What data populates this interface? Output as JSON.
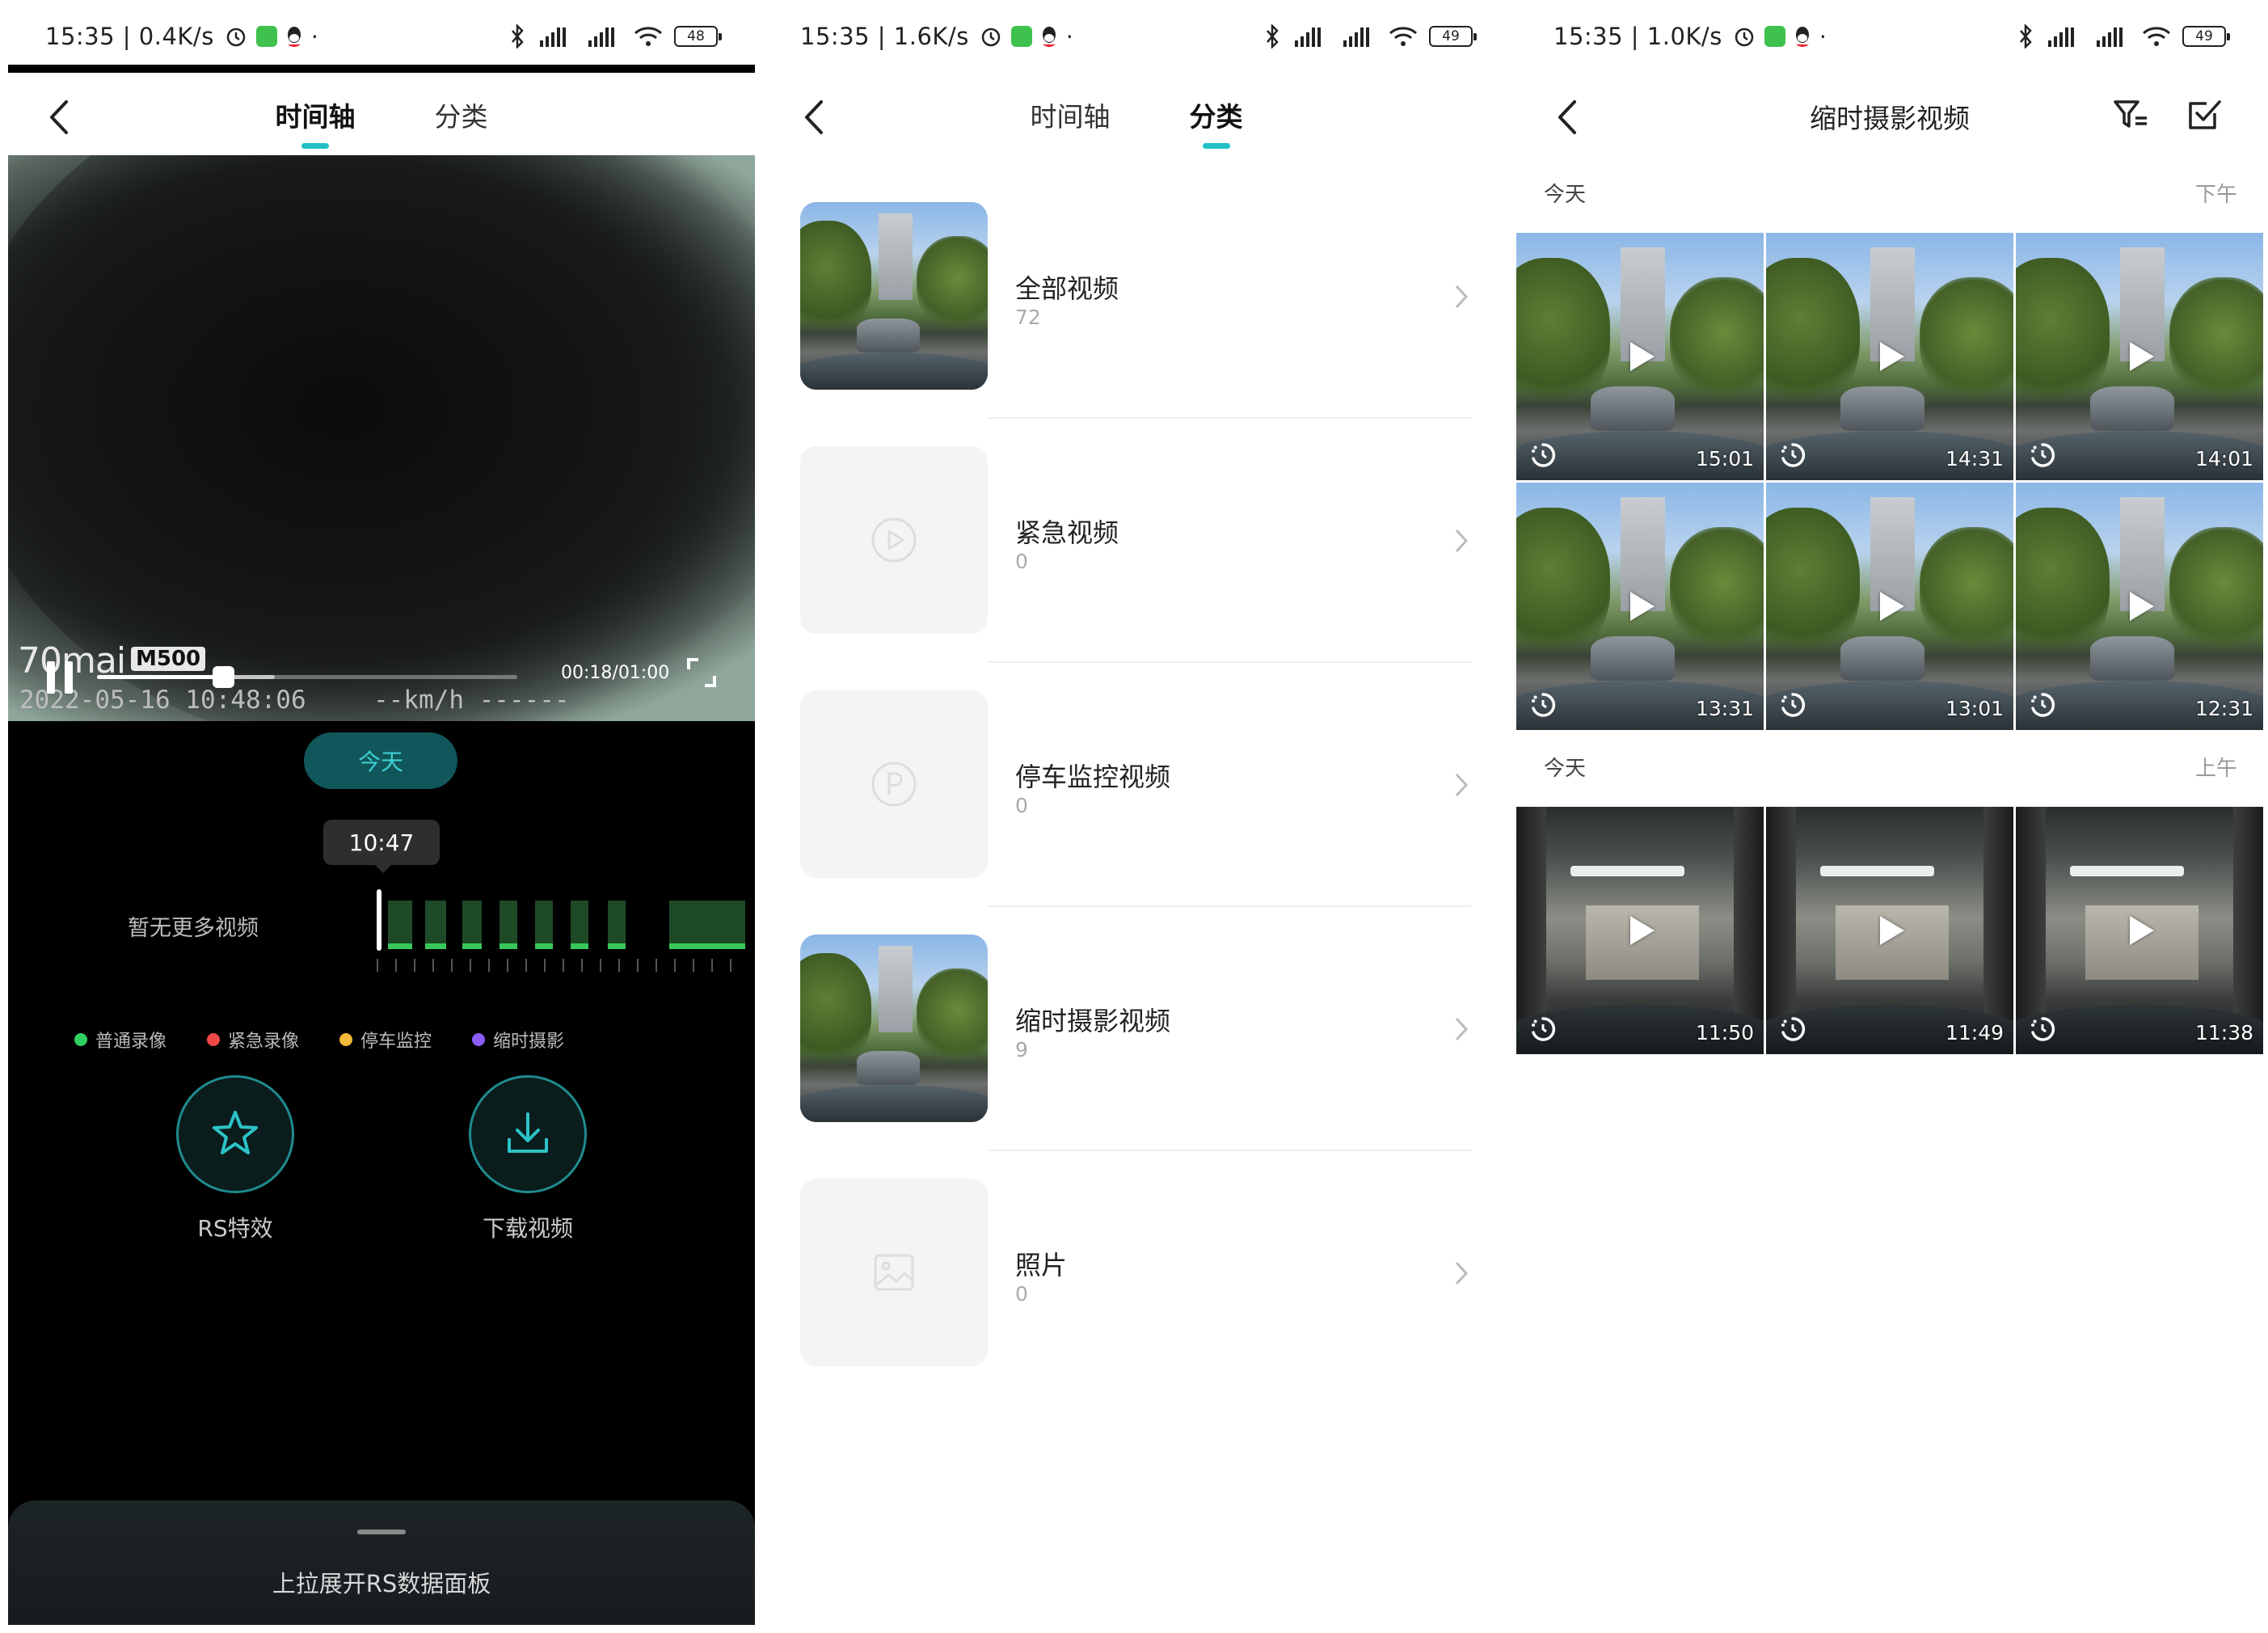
{
  "screen1": {
    "status": {
      "time": "15:35",
      "speed": "0.4K/s",
      "battery": "48"
    },
    "tabs": [
      "时间轴",
      "分类"
    ],
    "active_tab": 0,
    "video": {
      "brand": "70mai",
      "model": "M500",
      "datetime": "2022-05-16 10:48:06",
      "speed": "--km/h ------",
      "time_display": "00:18/01:00",
      "progress_fraction": 0.3
    },
    "today_label": "今天",
    "timeline_label": "10:47",
    "no_more": "暂无更多视频",
    "legend": [
      {
        "label": "普通录像",
        "color": "#2fd160"
      },
      {
        "label": "紧急录像",
        "color": "#f04848"
      },
      {
        "label": "停车监控",
        "color": "#f4b83a"
      },
      {
        "label": "缩时摄影",
        "color": "#8b5cf6"
      }
    ],
    "actions": [
      {
        "label": "RS特效",
        "icon": "star-icon"
      },
      {
        "label": "下载视频",
        "icon": "download-icon"
      }
    ],
    "panel_text": "上拉展开RS数据面板"
  },
  "screen2": {
    "status": {
      "time": "15:35",
      "speed": "1.6K/s",
      "battery": "49"
    },
    "tabs": [
      "时间轴",
      "分类"
    ],
    "active_tab": 1,
    "categories": [
      {
        "name": "全部视频",
        "count": "72",
        "thumb": "photo"
      },
      {
        "name": "紧急视频",
        "count": "0",
        "thumb": "play-circle-icon"
      },
      {
        "name": "停车监控视频",
        "count": "0",
        "thumb": "parking-icon"
      },
      {
        "name": "缩时摄影视频",
        "count": "9",
        "thumb": "photo"
      },
      {
        "name": "照片",
        "count": "0",
        "thumb": "image-icon"
      }
    ]
  },
  "screen3": {
    "status": {
      "time": "15:35",
      "speed": "1.0K/s",
      "battery": "49"
    },
    "title": "缩时摄影视频",
    "sections": [
      {
        "day": "今天",
        "period": "下午",
        "items": [
          {
            "time": "15:01",
            "scene": "street"
          },
          {
            "time": "14:31",
            "scene": "street"
          },
          {
            "time": "14:01",
            "scene": "street"
          },
          {
            "time": "13:31",
            "scene": "street"
          },
          {
            "time": "13:01",
            "scene": "street"
          },
          {
            "time": "12:31",
            "scene": "street"
          }
        ]
      },
      {
        "day": "今天",
        "period": "上午",
        "items": [
          {
            "time": "11:50",
            "scene": "garage"
          },
          {
            "time": "11:49",
            "scene": "garage"
          },
          {
            "time": "11:38",
            "scene": "garage"
          }
        ]
      }
    ]
  }
}
